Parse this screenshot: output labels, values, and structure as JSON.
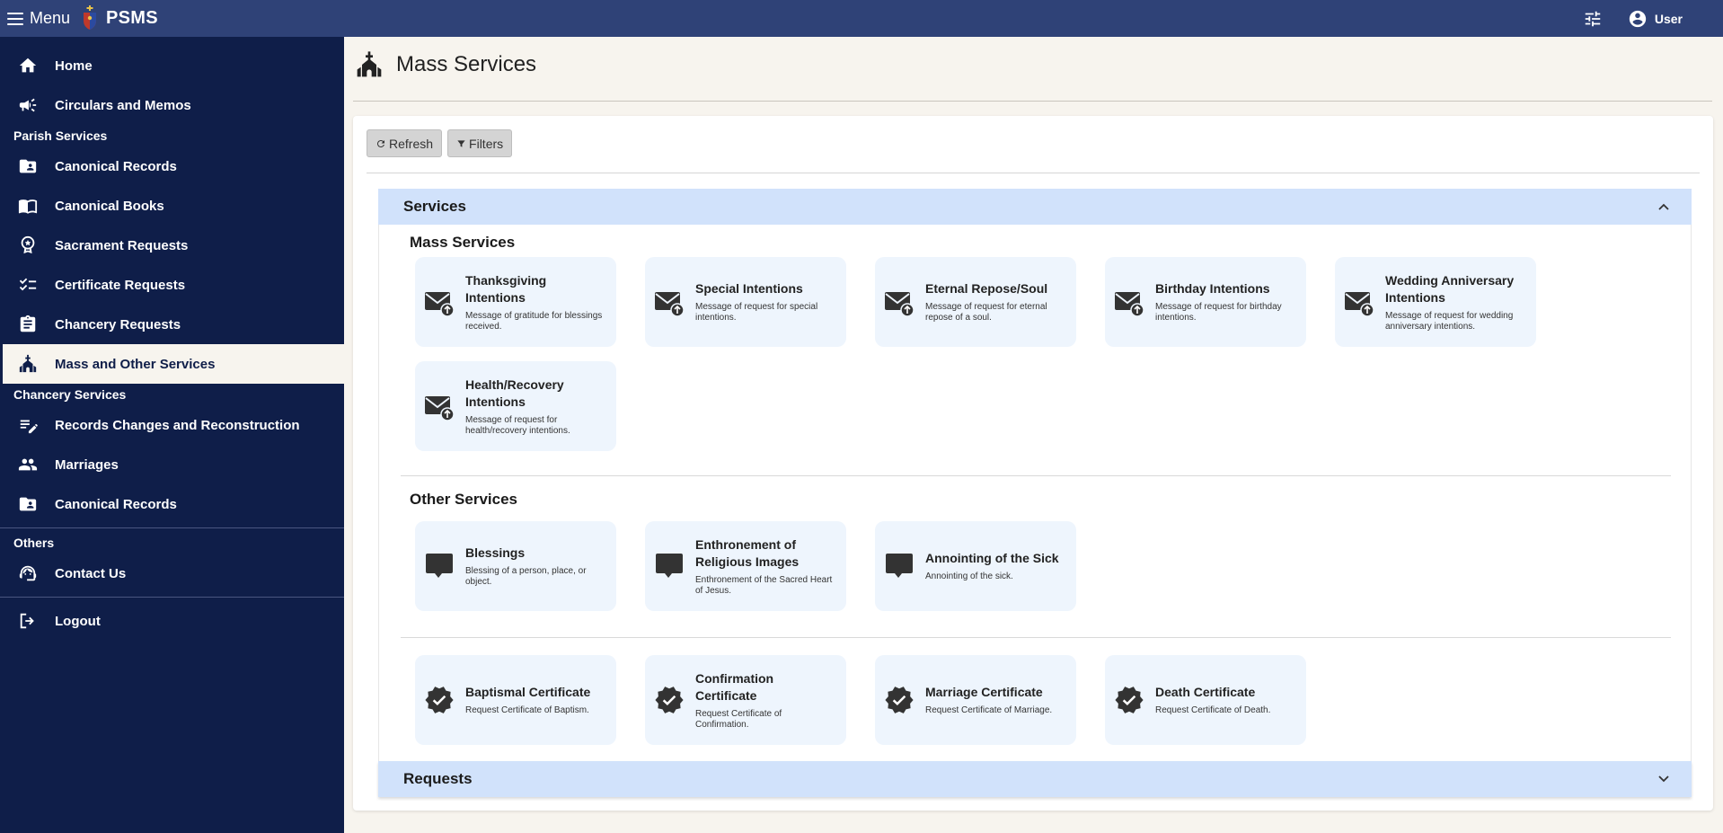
{
  "topbar": {
    "menu_label": "Menu",
    "brand": "PSMS",
    "user_label": "User"
  },
  "sidebar": {
    "items_top": [
      {
        "label": "Home",
        "icon": "home-icon"
      },
      {
        "label": "Circulars and Memos",
        "icon": "megaphone-icon"
      }
    ],
    "parish_heading": "Parish Services",
    "parish_items": [
      {
        "label": "Canonical Records",
        "icon": "contact-folder-icon"
      },
      {
        "label": "Canonical Books",
        "icon": "book-icon"
      },
      {
        "label": "Sacrament Requests",
        "icon": "badge-icon"
      },
      {
        "label": "Certificate Requests",
        "icon": "checklist-icon"
      },
      {
        "label": "Chancery Requests",
        "icon": "clipboard-icon"
      },
      {
        "label": "Mass and Other Services",
        "icon": "church-icon"
      }
    ],
    "chancery_heading": "Chancery Services",
    "chancery_items": [
      {
        "label": "Records Changes and Reconstruction",
        "icon": "edit-list-icon"
      },
      {
        "label": "Marriages",
        "icon": "people-icon"
      },
      {
        "label": "Canonical Records",
        "icon": "contact-folder-icon"
      }
    ],
    "others_heading": "Others",
    "others_items": [
      {
        "label": "Contact Us",
        "icon": "support-agent-icon"
      }
    ],
    "logout_label": "Logout"
  },
  "page": {
    "title": "Mass Services"
  },
  "toolbar": {
    "refresh_label": "Refresh",
    "filters_label": "Filters"
  },
  "services_panel": {
    "title": "Services",
    "mass_heading": "Mass Services",
    "mass": [
      {
        "title": "Thanksgiving Intentions",
        "desc": "Message of gratitude for blessings received."
      },
      {
        "title": "Special Intentions",
        "desc": "Message of request for special intentions."
      },
      {
        "title": "Eternal Repose/Soul",
        "desc": "Message of request for eternal repose of a soul."
      },
      {
        "title": "Birthday Intentions",
        "desc": "Message of request for birthday intentions."
      },
      {
        "title": "Wedding Anniversary Intentions",
        "desc": "Message of request for wedding anniversary intentions."
      },
      {
        "title": "Health/Recovery Intentions",
        "desc": "Message of request for health/recovery intentions."
      }
    ],
    "other_heading": "Other Services",
    "other": [
      {
        "title": "Blessings",
        "desc": "Blessing of a person, place, or object."
      },
      {
        "title": "Enthronement of Religious Images",
        "desc": "Enthronement of the Sacred Heart of Jesus."
      },
      {
        "title": "Annointing of the Sick",
        "desc": "Annointing of the sick."
      }
    ],
    "certificates": [
      {
        "title": "Baptismal Certificate",
        "desc": "Request Certificate of Baptism."
      },
      {
        "title": "Confirmation Certificate",
        "desc": "Request Certificate of Confirmation."
      },
      {
        "title": "Marriage Certificate",
        "desc": "Request Certificate of Marriage."
      },
      {
        "title": "Death Certificate",
        "desc": "Request Certificate of Death."
      }
    ]
  },
  "requests_panel": {
    "title": "Requests"
  },
  "colors": {
    "topbar": "#2f4277",
    "sidebar": "#0f1e49",
    "accordion_header": "#d1e2fb",
    "service_card": "#eef5fd"
  }
}
